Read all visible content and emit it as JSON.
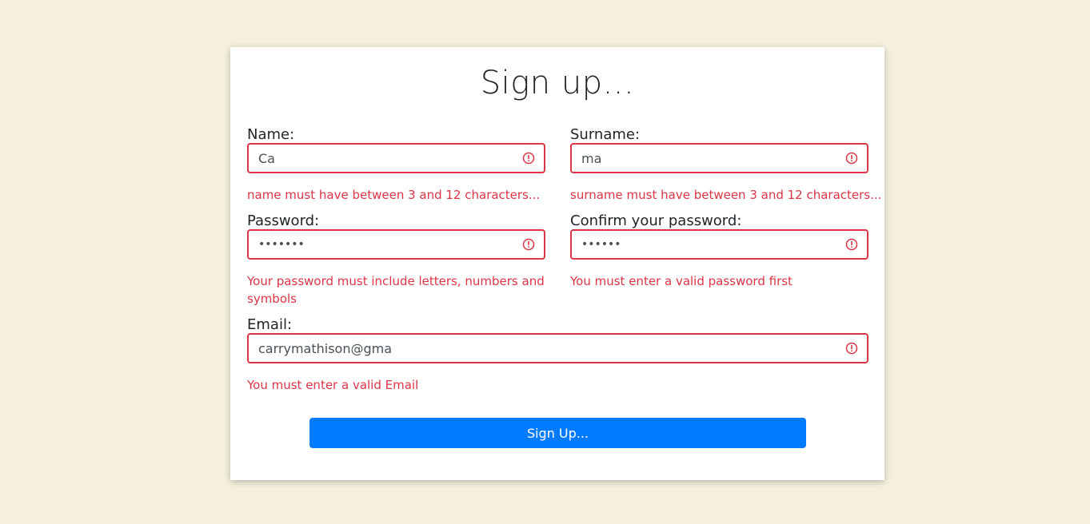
{
  "form": {
    "title": "Sign up...",
    "submit_label": "Sign Up...",
    "error_color": "#dc3545",
    "accent_color": "#007bff"
  },
  "fields": {
    "name": {
      "label": "Name:",
      "value": "Ca",
      "error": "name must have between 3 and 12 characters..."
    },
    "surname": {
      "label": "Surname:",
      "value": "ma",
      "error": "surname must have between 3 and 12 characters..."
    },
    "password": {
      "label": "Password:",
      "value": "•••••••",
      "error": "Your password must include letters, numbers and symbols"
    },
    "confirm_password": {
      "label": "Confirm your password:",
      "value": "••••••",
      "error": "You must enter a valid password first"
    },
    "email": {
      "label": "Email:",
      "value": "carrymathison@gma",
      "error": "You must enter a valid Email"
    }
  },
  "icons": {
    "error": "exclamation-circle-icon"
  }
}
